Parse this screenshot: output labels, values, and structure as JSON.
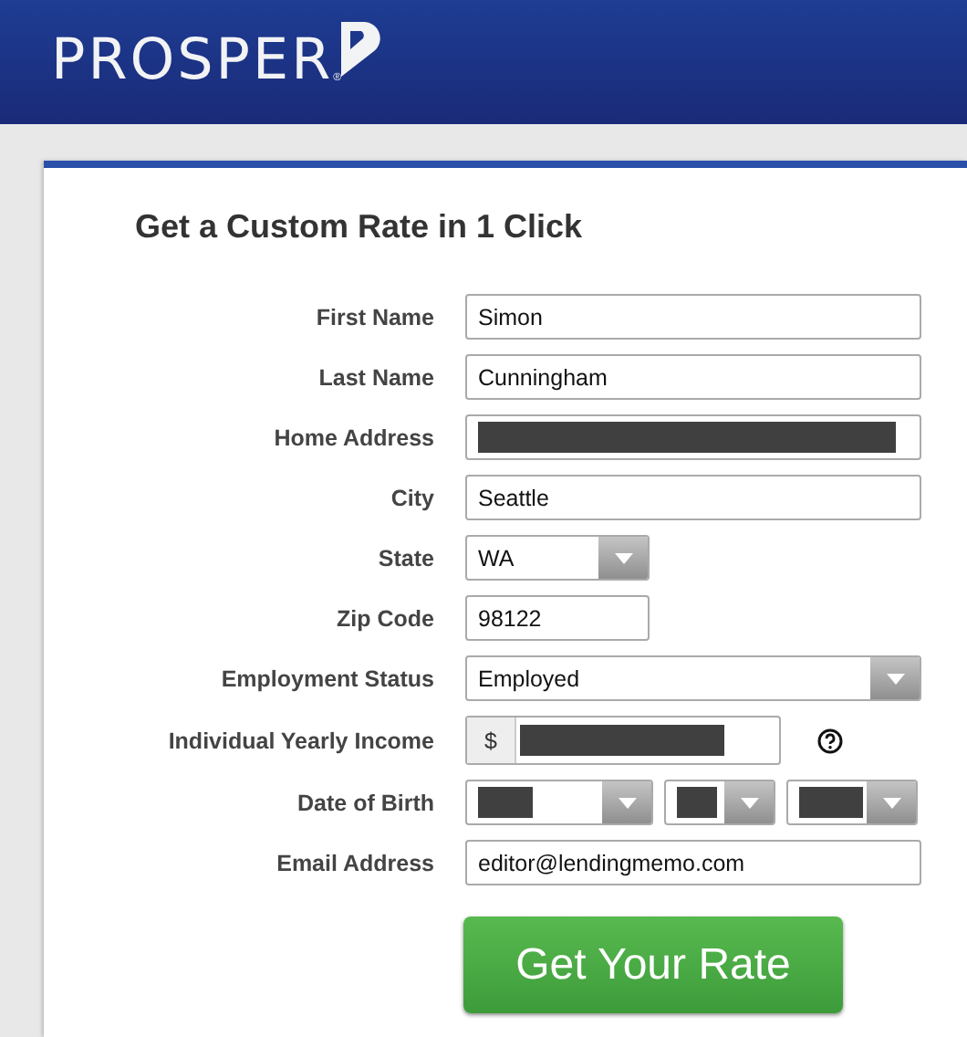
{
  "header": {
    "logo": "PROSPER",
    "registered_mark": "®"
  },
  "form": {
    "title": "Get a Custom Rate in 1 Click",
    "fields": [
      {
        "label": "First Name",
        "kind": "text",
        "value": "Simon"
      },
      {
        "label": "Last Name",
        "kind": "text",
        "value": "Cunningham"
      },
      {
        "label": "Home Address",
        "kind": "text",
        "redacted": true
      },
      {
        "label": "City",
        "kind": "text",
        "value": "Seattle"
      },
      {
        "label": "State",
        "kind": "short-select",
        "value": "WA"
      },
      {
        "label": "Zip Code",
        "kind": "short-text",
        "value": "98122"
      },
      {
        "label": "Employment Status",
        "kind": "select",
        "value": "Employed"
      },
      {
        "label": "Individual Yearly Income",
        "kind": "currency",
        "prefix": "$",
        "redacted": true,
        "help": true
      },
      {
        "label": "Date of Birth",
        "kind": "date",
        "parts": [
          {
            "redacted": true
          },
          {
            "redacted": true
          },
          {
            "redacted": true
          }
        ]
      },
      {
        "label": "Email Address",
        "kind": "text",
        "value": "editor@lendingmemo.com"
      }
    ],
    "submit": "Get Your Rate"
  }
}
